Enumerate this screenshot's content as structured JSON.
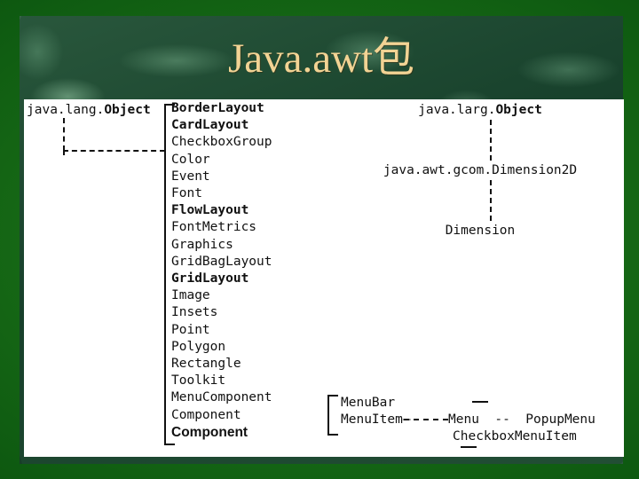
{
  "slide": {
    "title": "Java.awt包",
    "title_color": "#f2d394",
    "background_color": "#0b4f10",
    "panel_color": "#ffffff"
  },
  "left_hierarchy": {
    "root_prefix": "java.lang.",
    "root_bold": "Object"
  },
  "class_list": [
    {
      "label": "BorderLayout",
      "style": "bold"
    },
    {
      "label": "CardLayout",
      "style": "bold"
    },
    {
      "label": "CheckboxGroup",
      "style": "normal"
    },
    {
      "label": "Color",
      "style": "normal"
    },
    {
      "label": "Event",
      "style": "normal"
    },
    {
      "label": "Font",
      "style": "normal"
    },
    {
      "label": "FlowLayout",
      "style": "bold"
    },
    {
      "label": "FontMetrics",
      "style": "normal"
    },
    {
      "label": "Graphics",
      "style": "normal"
    },
    {
      "label": "GridBagLayout",
      "style": "normal"
    },
    {
      "label": "GridLayout",
      "style": "bold"
    },
    {
      "label": "Image",
      "style": "normal"
    },
    {
      "label": "Insets",
      "style": "normal"
    },
    {
      "label": "Point",
      "style": "normal"
    },
    {
      "label": "Polygon",
      "style": "normal"
    },
    {
      "label": "Rectangle",
      "style": "normal"
    },
    {
      "label": "Toolkit",
      "style": "normal"
    },
    {
      "label": "MenuComponent",
      "style": "normal"
    },
    {
      "label": "Component",
      "style": "normal"
    },
    {
      "label": "Component",
      "style": "sans-bold"
    }
  ],
  "right_hierarchy": {
    "level1_prefix": "java.larg.",
    "level1_bold": "Object",
    "level2": "java.awt.gcom.Dimension2D",
    "level3": "Dimension"
  },
  "menu_cluster": {
    "menu_bar": "MenuBar",
    "menu_item": "MenuItem—",
    "menu": "Menu  --  PopupMenu",
    "checkbox_menu_item": "CheckboxMenuItem"
  }
}
